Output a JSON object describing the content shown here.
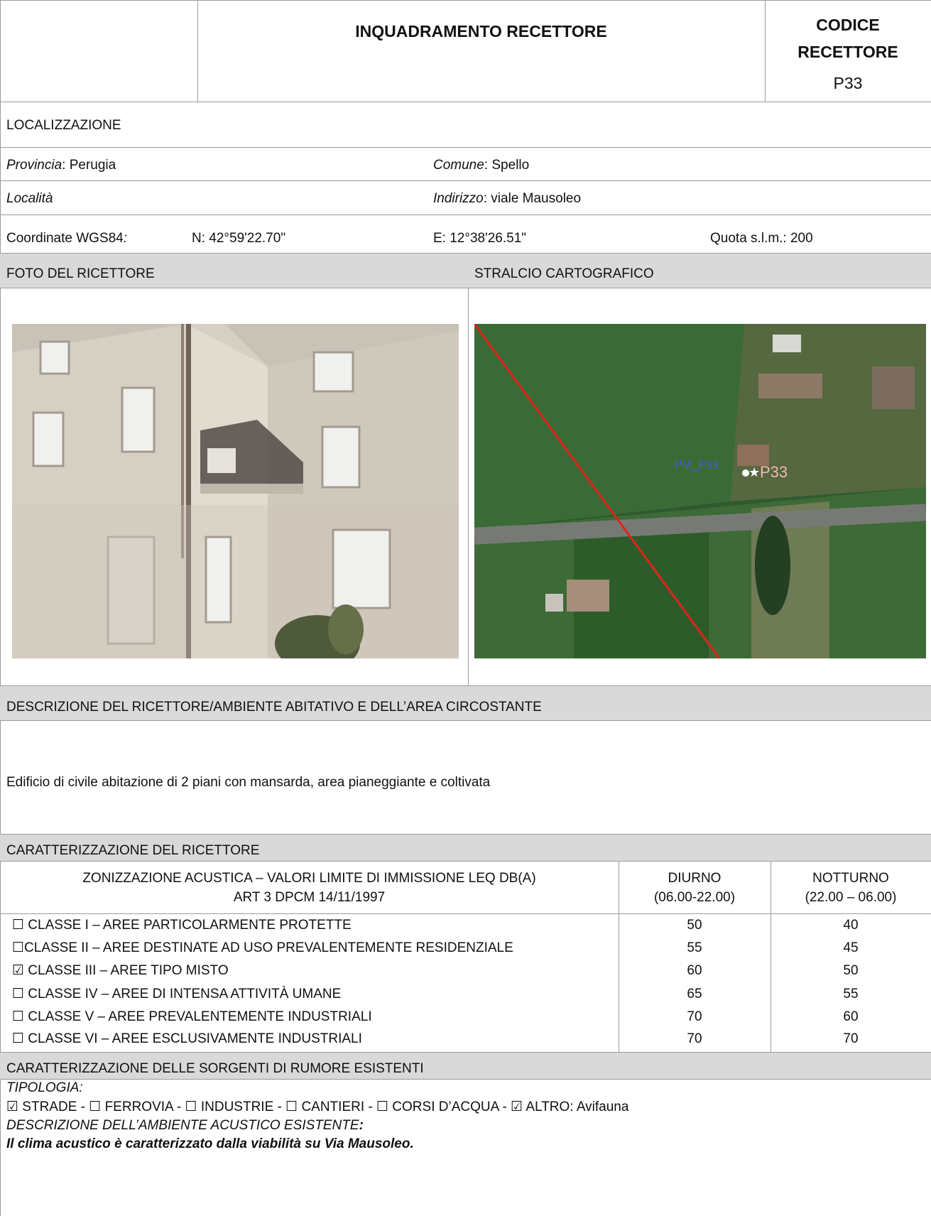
{
  "header": {
    "title": "INQUADRAMENTO RECETTORE",
    "code_label_line1": "CODICE",
    "code_label_line2": "RECETTORE",
    "code_value": "P33"
  },
  "location": {
    "section_title": "LOCALIZZAZIONE",
    "provincia_label": "Provincia",
    "provincia_value": ": Perugia",
    "comune_label": "Comune",
    "comune_value": ": Spello",
    "localita_label": "Località",
    "indirizzo_label": "Indirizzo",
    "indirizzo_value": ": viale Mausoleo",
    "coord_label": "Coordinate WGS84",
    "coord_colon": ":",
    "north": "N: 42°59'22.70\"",
    "east": "E: 12°38'26.51\"",
    "quota": "Quota s.l.m.: 200"
  },
  "media": {
    "photo_title": "FOTO DEL RICETTORE",
    "map_title": "STRALCIO CARTOGRAFICO",
    "map_label_pm": "PM_P33",
    "map_label_p": "P33"
  },
  "description": {
    "section_title": "DESCRIZIONE DEL RICETTORE/AMBIENTE ABITATIVO E DELL’AREA CIRCOSTANTE",
    "text": "Edificio di civile abitazione di 2 piani con mansarda, area pianeggiante e coltivata"
  },
  "characterization": {
    "section_title": "CARATTERIZZAZIONE DEL RICETTORE",
    "header_line1": "ZONIZZAZIONE ACUSTICA – VALORI LIMITE DI IMMISSIONE LEQ DB(A)",
    "header_line2": "ART 3 DPCM 14/11/1997",
    "day_line1": "DIURNO",
    "day_line2": "(06.00-22.00)",
    "night_line1": "NOTTURNO",
    "night_line2": "(22.00 – 06.00)",
    "rows": [
      {
        "label": "☐ CLASSE I – AREE PARTICOLARMENTE PROTETTE",
        "day": "50",
        "night": "40"
      },
      {
        "label": "☐CLASSE II – AREE DESTINATE AD USO PREVALENTEMENTE RESIDENZIALE",
        "day": "55",
        "night": "45"
      },
      {
        "label": "☑  CLASSE III – AREE TIPO MISTO",
        "day": "60",
        "night": "50"
      },
      {
        "label": "☐ CLASSE IV – AREE DI INTENSA ATTIVITÀ UMANE",
        "day": "65",
        "night": "55"
      },
      {
        "label": "☐ CLASSE V – AREE PREVALENTEMENTE INDUSTRIALI",
        "day": "70",
        "night": "60"
      },
      {
        "label": "☐ CLASSE VI – AREE ESCLUSIVAMENTE INDUSTRIALI",
        "day": "70",
        "night": "70"
      }
    ]
  },
  "sources": {
    "section_title": "CARATTERIZZAZIONE DELLE SORGENTI DI RUMORE ESISTENTI",
    "tipologia_label": "TIPOLOGIA:",
    "tipologia_list": "☑ STRADE - ☐ FERROVIA - ☐ INDUSTRIE - ☐ CANTIERI - ☐ CORSI D’ACQUA - ☑ ALTRO: Avifauna",
    "ambiente_label": "DESCRIZIONE DELL’AMBIENTE ACUSTICO ESISTENTE",
    "ambiente_colon": ":",
    "ambiente_text": "Il clima acustico è caratterizzato dalla viabilità su Via Mausoleo."
  },
  "colors": {
    "band_gray": "#d9d9d9",
    "border": "#9a9a9a",
    "map_line": "#e0231b"
  }
}
